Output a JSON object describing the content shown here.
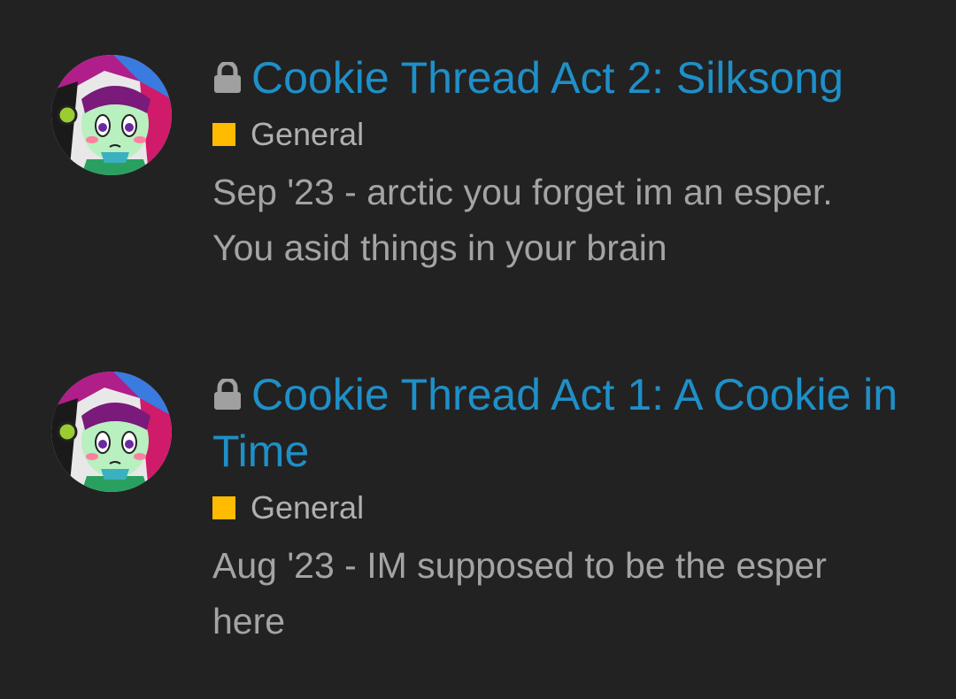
{
  "results": [
    {
      "title": "Cookie Thread Act 2: Silksong",
      "locked": true,
      "category": {
        "name": "General",
        "color": "#ffbb00"
      },
      "date": "Sep '23",
      "separator": " - ",
      "excerpt": "arctic you forget im an esper. You asid things in your brain"
    },
    {
      "title": "Cookie Thread Act 1: A Cookie in Time",
      "locked": true,
      "category": {
        "name": "General",
        "color": "#ffbb00"
      },
      "date": "Aug '23",
      "separator": " - ",
      "excerpt": "IM supposed to be the esper here"
    }
  ],
  "colors": {
    "background": "#222222",
    "link": "#1f8fc7",
    "muted_text": "#a4a4a4",
    "lock_icon": "#a0a0a0"
  },
  "icons": {
    "lock": "lock-icon",
    "avatar": "user-avatar"
  }
}
